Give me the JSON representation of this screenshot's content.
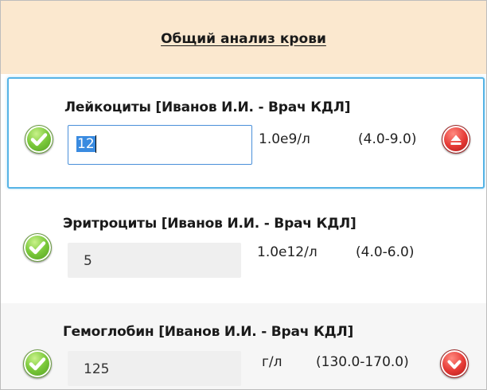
{
  "form": {
    "title": "Общий анализ крови"
  },
  "tests": [
    {
      "name": "Лейкоциты [Иванов И.И. - Врач КДЛ]",
      "value": "12",
      "unit": "1.0e9/л",
      "range": "(4.0-9.0)",
      "status_icon": "check-ok",
      "flag_icon": "arrow-up-high",
      "active": true
    },
    {
      "name": "Эритроциты  [Иванов И.И. - Врач КДЛ]",
      "value": "5",
      "unit": "1.0e12/л",
      "range": "(4.0-6.0)",
      "status_icon": "check-ok",
      "flag_icon": null,
      "active": false
    },
    {
      "name": "Гемоглобин  [Иванов И.И. - Врач КДЛ]",
      "value": "125",
      "unit": "г/л",
      "range": "(130.0-170.0)",
      "status_icon": "check-ok",
      "flag_icon": "arrow-down-low",
      "active": false
    }
  ],
  "colors": {
    "header_bg": "#fbe8cf",
    "focus_border": "#56b4e6",
    "ok_green": "#7bc93b",
    "alert_red": "#e53935"
  }
}
